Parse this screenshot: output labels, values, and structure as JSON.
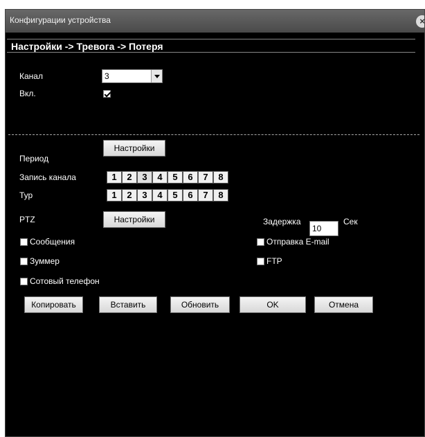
{
  "window": {
    "title": "Конфигурации устройства",
    "close_glyph": "×"
  },
  "breadcrumb": "Настройки -> Тревога -> Потеря",
  "channel": {
    "label": "Канал",
    "value": "3"
  },
  "enabled": {
    "label": "Вкл.",
    "checked": true
  },
  "period": {
    "label": "Период",
    "button": "Настройки"
  },
  "record_channel": {
    "label": "Запись канала",
    "channels": [
      "1",
      "2",
      "3",
      "4",
      "5",
      "6",
      "7",
      "8"
    ]
  },
  "tour": {
    "label": "Тур",
    "channels": [
      "1",
      "2",
      "3",
      "4",
      "5",
      "6",
      "7",
      "8"
    ]
  },
  "ptz": {
    "label": "PTZ",
    "button": "Настройки"
  },
  "delay": {
    "label": "Задержка",
    "value": "10",
    "unit": "Сек"
  },
  "options": {
    "messages": "Сообщения",
    "buzzer": "Зуммер",
    "mobile": "Сотовый телефон",
    "email": "Отправка E-mail",
    "ftp": "FTP"
  },
  "buttons": {
    "copy": "Копировать",
    "paste": "Вставить",
    "refresh": "Обновить",
    "ok": "OK",
    "cancel": "Отмена"
  }
}
